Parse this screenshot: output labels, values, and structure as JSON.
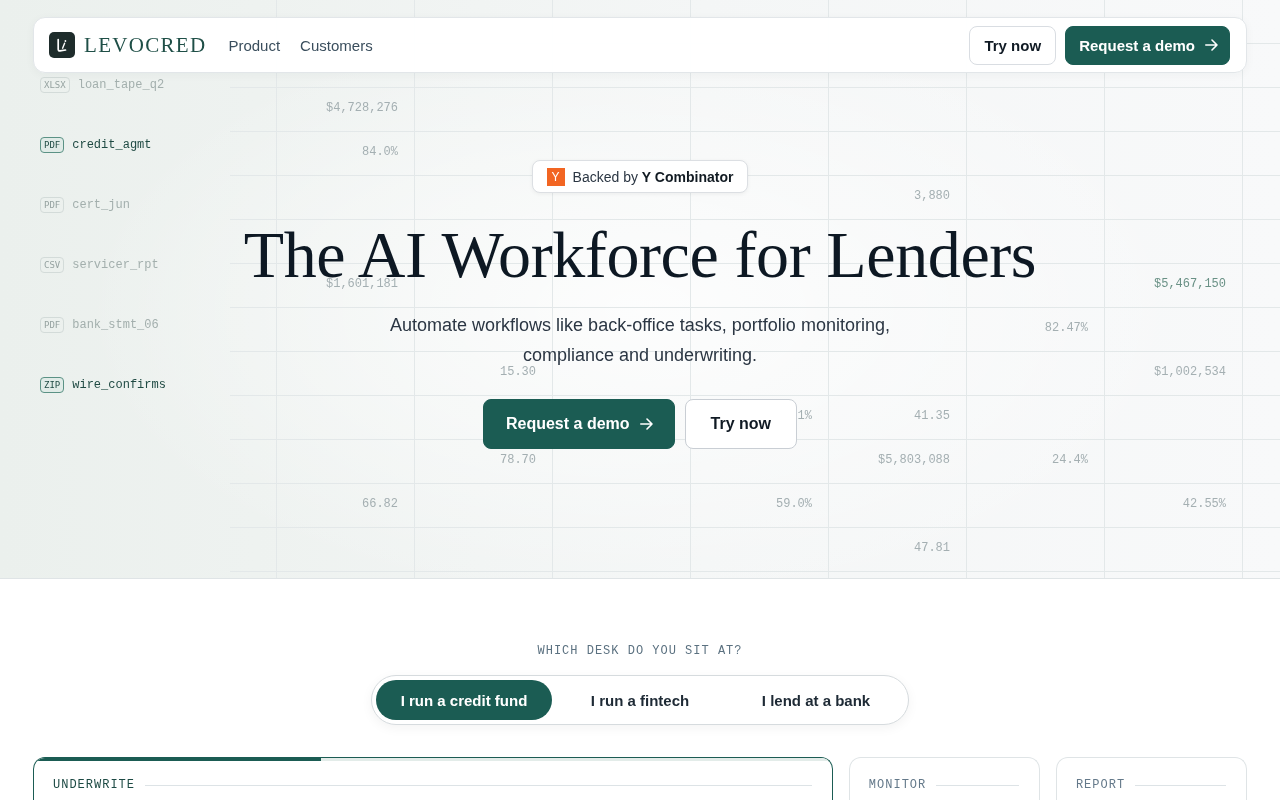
{
  "nav": {
    "logo_text": "LEVOCRED",
    "links": [
      {
        "label": "Product"
      },
      {
        "label": "Customers"
      }
    ],
    "buttons": [
      {
        "label": "Try now",
        "kind": "secondary"
      },
      {
        "label": "Request a demo",
        "kind": "primary"
      }
    ]
  },
  "file_list": [
    {
      "type": "XLSX",
      "name": "loan_tape_q2",
      "active": false
    },
    {
      "type": "PDF",
      "name": "credit_agmt",
      "active": true
    },
    {
      "type": "PDF",
      "name": "cert_jun",
      "active": false
    },
    {
      "type": "CSV",
      "name": "servicer_rpt",
      "active": false
    },
    {
      "type": "PDF",
      "name": "bank_stmt_06",
      "active": false
    },
    {
      "type": "ZIP",
      "name": "wire_confirms",
      "active": true
    }
  ],
  "data_grid": {
    "row_3": {
      "column_2": {
        "text": "$4,728,276",
        "highlighted": false
      }
    },
    "row_4": {
      "column_2": {
        "text": "84.0%",
        "highlighted": false
      }
    },
    "row_5": {
      "column_6": {
        "text": "3,880",
        "highlighted": false
      }
    },
    "row_7": {
      "column_2": {
        "text": "$1,601,181",
        "highlighted": false
      },
      "column_8": {
        "text": "$5,467,150",
        "highlighted": true
      }
    },
    "row_8": {
      "column_7": {
        "text": "82.47%",
        "highlighted": false
      }
    },
    "row_9": {
      "column_3": {
        "text": "15.30",
        "highlighted": false
      },
      "column_8": {
        "text": "$1,002,534",
        "highlighted": false
      }
    },
    "row_10": {
      "column_5": {
        "text": "1%",
        "highlighted": false
      },
      "column_6": {
        "text": "41.35",
        "highlighted": false
      }
    },
    "row_11": {
      "column_3": {
        "text": "78.70",
        "highlighted": false
      },
      "column_6": {
        "text": "$5,803,088",
        "highlighted": false
      },
      "column_7": {
        "text": "24.4%",
        "highlighted": false
      }
    },
    "row_12": {
      "column_2": {
        "text": "66.82",
        "highlighted": false
      },
      "column_5": {
        "text": "59.0%",
        "highlighted": false
      },
      "column_8": {
        "text": "42.55%",
        "highlighted": false
      }
    },
    "row_13": {
      "column_6": {
        "text": "47.81",
        "highlighted": false
      }
    }
  },
  "hero": {
    "badge": {
      "logo_letter": "Y",
      "text": "Backed by **Y Combinator**"
    },
    "title": "The AI Workforce for Lenders",
    "subtitle": "Automate workflows like back-office tasks, portfolio monitoring, compliance and underwriting.",
    "buttons": [
      {
        "label": "Request a demo",
        "kind": "primary"
      },
      {
        "label": "Try now",
        "kind": "secondary"
      }
    ]
  },
  "desk_picker": {
    "heading": "WHICH DESK DO YOU SIT AT?",
    "options": [
      {
        "label": "I run a credit fund",
        "selected": true
      },
      {
        "label": "I run a fintech",
        "selected": false
      },
      {
        "label": "I lend at a bank",
        "selected": false
      }
    ]
  },
  "workflow_cards": [
    {
      "label": "UNDERWRITE",
      "selected": true,
      "level": 0.36
    },
    {
      "label": "MONITOR",
      "selected": false
    },
    {
      "label": "REPORT",
      "selected": false
    }
  ]
}
